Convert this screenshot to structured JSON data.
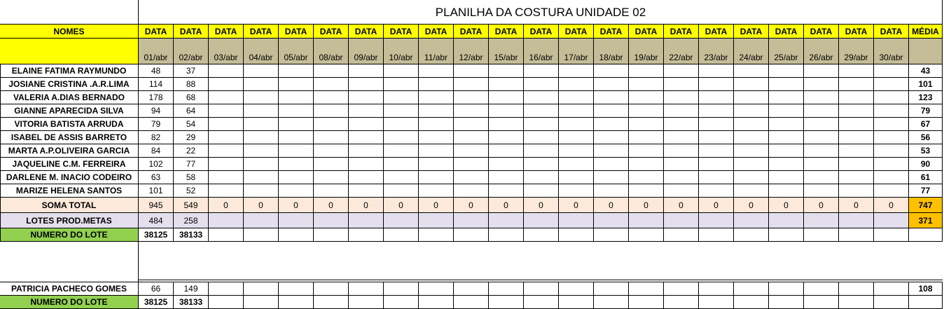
{
  "title": "PLANILHA DA COSTURA UNIDADE 02",
  "header": {
    "names_label": "NOMES",
    "date_label": "DATA",
    "avg_label": "MÉDIA",
    "dates": [
      "01/abr",
      "02/abr",
      "03/abr",
      "04/abr",
      "05/abr",
      "08/abr",
      "09/abr",
      "10/abr",
      "11/abr",
      "12/abr",
      "15/abr",
      "16/abr",
      "17/abr",
      "18/abr",
      "19/abr",
      "22/abr",
      "23/abr",
      "24/abr",
      "25/abr",
      "26/abr",
      "29/abr",
      "30/abr"
    ]
  },
  "rows": [
    {
      "name": "ELAINE FATIMA RAYMUNDO",
      "values": [
        "48",
        "37"
      ],
      "avg": "43"
    },
    {
      "name": "JOSIANE CRISTINA .A.R.LIMA",
      "values": [
        "114",
        "88"
      ],
      "avg": "101"
    },
    {
      "name": "VALERIA A.DIAS BERNADO",
      "values": [
        "178",
        "68"
      ],
      "avg": "123"
    },
    {
      "name": "GIANNE APARECIDA SILVA",
      "values": [
        "94",
        "64"
      ],
      "avg": "79"
    },
    {
      "name": "VITORIA BATISTA ARRUDA",
      "values": [
        "79",
        "54"
      ],
      "avg": "67"
    },
    {
      "name": "ISABEL DE ASSIS BARRETO",
      "values": [
        "82",
        "29"
      ],
      "avg": "56"
    },
    {
      "name": "MARTA A.P.OLIVEIRA GARCIA",
      "values": [
        "84",
        "22"
      ],
      "avg": "53"
    },
    {
      "name": "JAQUELINE C.M. FERREIRA",
      "values": [
        "102",
        "77"
      ],
      "avg": "90"
    },
    {
      "name": "DARLENE M. INACIO CODEIRO",
      "values": [
        "63",
        "58"
      ],
      "avg": "61"
    },
    {
      "name": "MARIZE HELENA SANTOS",
      "values": [
        "101",
        "52"
      ],
      "avg": "77"
    }
  ],
  "total": {
    "label": "SOMA TOTAL",
    "values": [
      "945",
      "549",
      "0",
      "0",
      "0",
      "0",
      "0",
      "0",
      "0",
      "0",
      "0",
      "0",
      "0",
      "0",
      "0",
      "0",
      "0",
      "0",
      "0",
      "0",
      "0",
      "0"
    ],
    "avg": "747"
  },
  "lotes": {
    "label": "LOTES PROD.METAS",
    "values": [
      "484",
      "258"
    ],
    "avg": "371"
  },
  "lot_number": {
    "label": "NUMERO DO LOTE",
    "values": [
      "38125",
      "38133"
    ]
  },
  "extra": {
    "row": {
      "name": "PATRICIA PACHECO GOMES",
      "values": [
        "66",
        "149"
      ],
      "avg": "108"
    },
    "lot_number": {
      "label": "NUMERO DO LOTE",
      "values": [
        "38125",
        "38133"
      ]
    }
  },
  "colors": {
    "header": "#ffff00",
    "date_row": "#c4bd97",
    "total": "#fde9d9",
    "lotes": "#e4dfec",
    "lot_number": "#92d050",
    "avg_highlight": "#ffc000"
  }
}
